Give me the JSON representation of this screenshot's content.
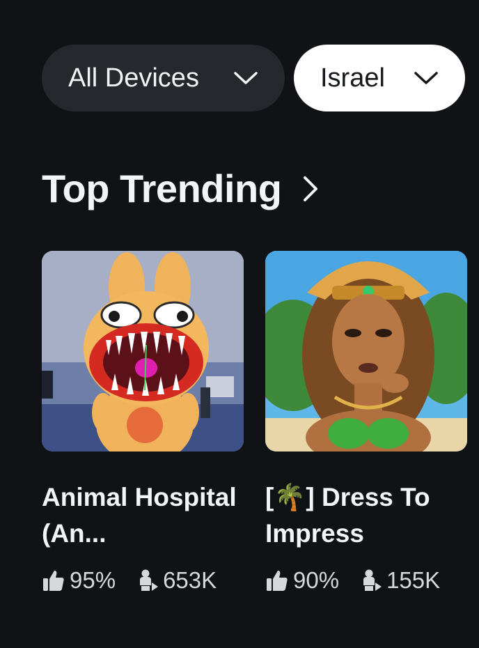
{
  "filters": {
    "devices": {
      "label": "All Devices",
      "icon": "chevron-down-icon"
    },
    "country": {
      "label": "Israel",
      "icon": "chevron-down-icon"
    }
  },
  "section": {
    "title": "Top Trending",
    "icon": "chevron-right-icon"
  },
  "games": [
    {
      "title": "Animal Hospital (An...",
      "rating": "95%",
      "players": "653K",
      "rating_icon": "thumbs-up-icon",
      "players_icon": "players-icon"
    },
    {
      "title": "[🌴] Dress To Impress",
      "rating": "90%",
      "players": "155K",
      "rating_icon": "thumbs-up-icon",
      "players_icon": "players-icon"
    }
  ]
}
